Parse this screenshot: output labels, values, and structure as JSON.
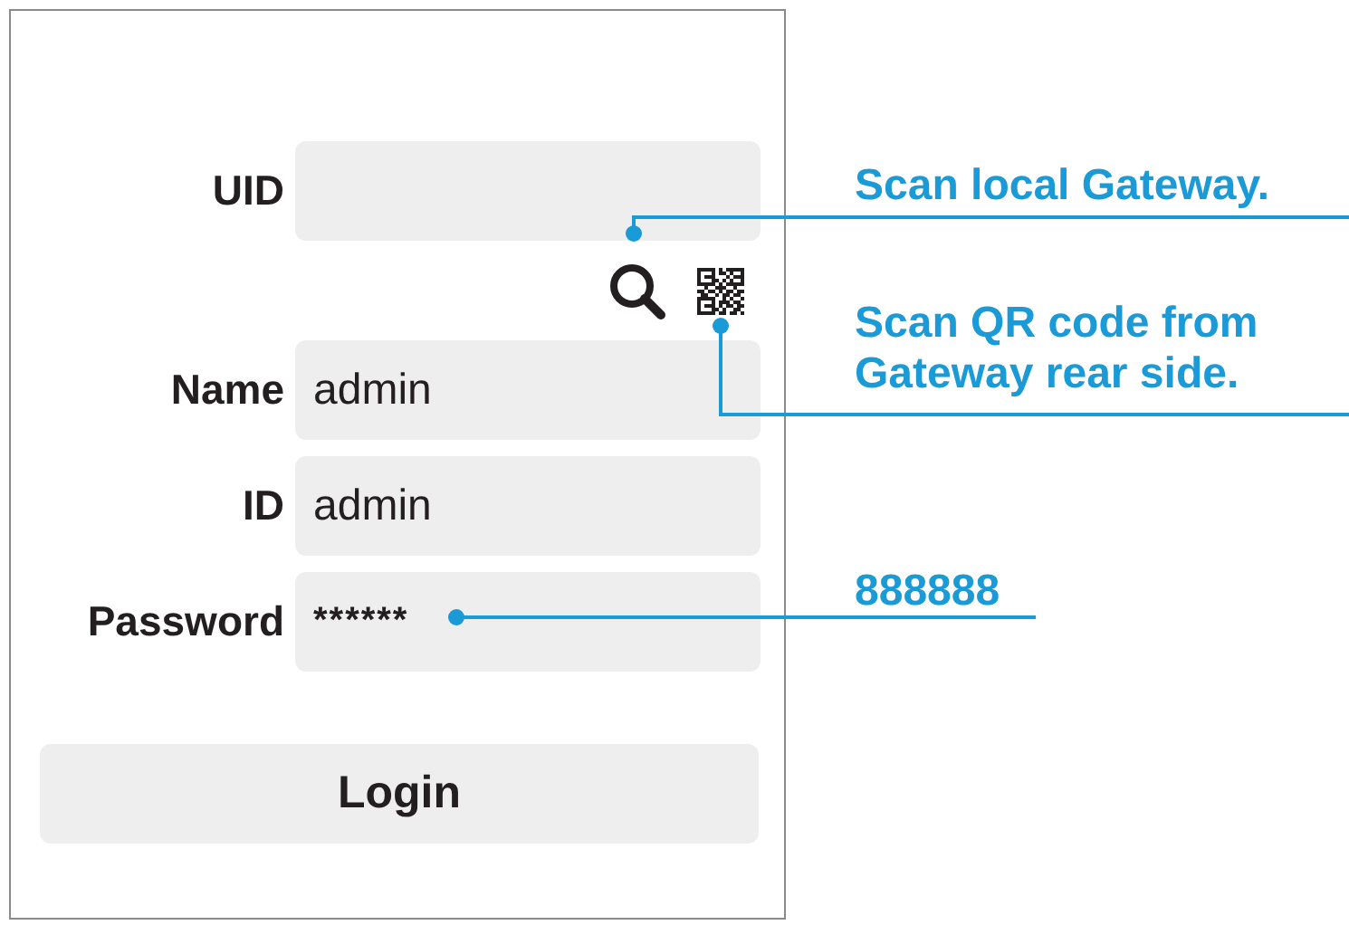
{
  "fields": [
    {
      "label": "UID"
    },
    {
      "label": "Name",
      "value": "admin"
    },
    {
      "label": "ID",
      "value": "admin"
    },
    {
      "label": "Password",
      "value": "******"
    }
  ],
  "login_button": "Login",
  "callouts": [
    {
      "kind": "search",
      "lines": [
        "Scan local Gateway."
      ]
    },
    {
      "kind": "qr",
      "lines": [
        "Scan QR code from",
        "Gateway rear side."
      ]
    },
    {
      "kind": "password",
      "lines": [
        "888888"
      ]
    }
  ]
}
